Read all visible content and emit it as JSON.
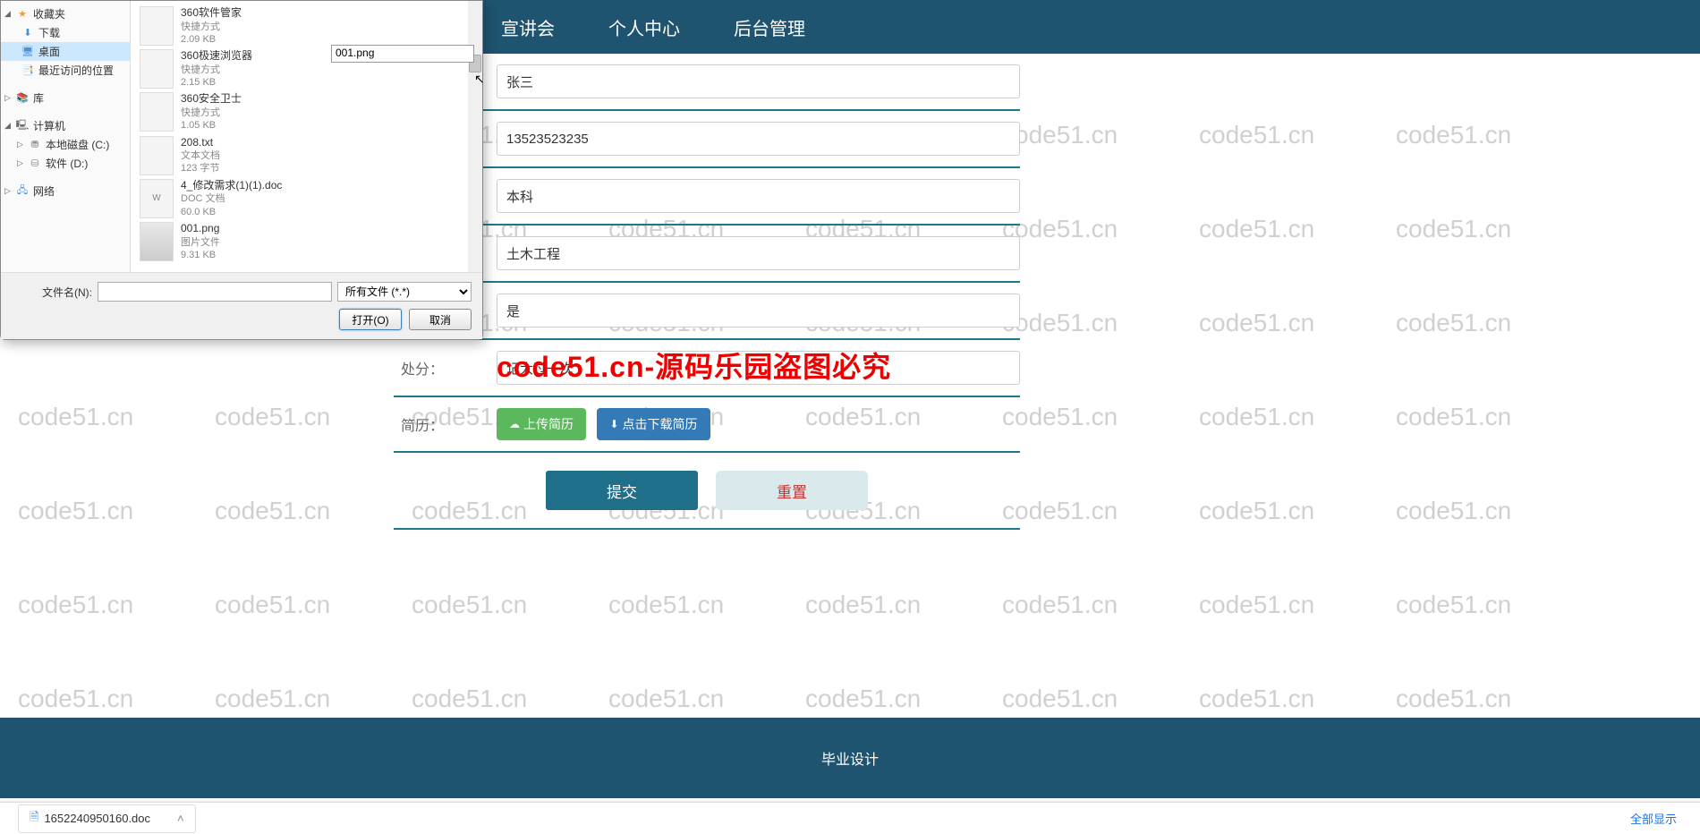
{
  "nav": {
    "item1": "宣讲会",
    "item2": "个人中心",
    "item3": "后台管理"
  },
  "form": {
    "name_value": "张三",
    "phone_value": "13523523235",
    "edu_value": "本科",
    "major_value": "土木工程",
    "flag_value": "是",
    "punish_label": "处分：",
    "punish_value": "记大过一次",
    "resume_label": "简历：",
    "upload_btn": "上传简历",
    "download_btn": "点击下载简历",
    "submit": "提交",
    "reset": "重置"
  },
  "footer": {
    "text": "毕业设计"
  },
  "download_bar": {
    "file": "1652240950160.doc",
    "show_all": "全部显示"
  },
  "dialog": {
    "filename_label": "文件名(N):",
    "filename_value": "",
    "filter": "所有文件 (*.*)",
    "open_btn": "打开(O)",
    "cancel_btn": "取消",
    "preview_name": "001.png",
    "sidebar": {
      "fav": "收藏夹",
      "downloads": "下载",
      "desktop": "桌面",
      "recent": "最近访问的位置",
      "library": "库",
      "computer": "计算机",
      "drive_c": "本地磁盘 (C:)",
      "drive_d": "软件 (D:)",
      "network": "网络"
    },
    "files": [
      {
        "name": "001.png",
        "type": "图片文件",
        "size": "9.31 KB",
        "icon": "img"
      },
      {
        "name": "4_修改需求(1)(1).doc",
        "type": "DOC 文档",
        "size": "60.0 KB",
        "icon": "W"
      },
      {
        "name": "208.txt",
        "type": "文本文档",
        "size": "123 字节",
        "icon": ""
      },
      {
        "name": "360安全卫士",
        "type": "快捷方式",
        "size": "1.05 KB",
        "icon": ""
      },
      {
        "name": "360极速浏览器",
        "type": "快捷方式",
        "size": "2.15 KB",
        "icon": ""
      },
      {
        "name": "360软件管家",
        "type": "快捷方式",
        "size": "2.09 KB",
        "icon": ""
      }
    ]
  },
  "watermark": "code51.cn",
  "red_wm": "code51.cn-源码乐园盗图必究"
}
